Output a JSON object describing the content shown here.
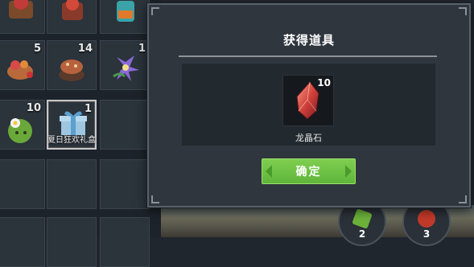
{
  "inventory": {
    "slots": [
      {
        "count": "",
        "name": "",
        "icon": "red-cake-icon"
      },
      {
        "count": "",
        "name": "",
        "icon": "teal-jar-icon"
      },
      {
        "count": "5",
        "name": "",
        "icon": "fruit-bowl-icon"
      },
      {
        "count": "14",
        "name": "",
        "icon": "mushroom-stew-icon"
      },
      {
        "count": "1",
        "name": "",
        "icon": "purple-flower-icon"
      },
      {
        "count": "10",
        "name": "",
        "icon": "green-flower-bush-icon"
      },
      {
        "count": "1",
        "name": "夏日狂欢礼盒",
        "icon": "gift-box-icon"
      }
    ],
    "bubbles": [
      {
        "count": "2",
        "icon": "green-item-icon"
      },
      {
        "count": "3",
        "icon": "red-item-icon"
      }
    ]
  },
  "modal": {
    "title": "获得道具",
    "reward": {
      "name": "龙晶石",
      "quantity": "10",
      "icon": "dragon-crystal-icon"
    },
    "confirm_label": "确定"
  },
  "colors": {
    "confirm_green": "#6cc244",
    "modal_bg": "#2f363d",
    "crystal": "#d2413a"
  }
}
